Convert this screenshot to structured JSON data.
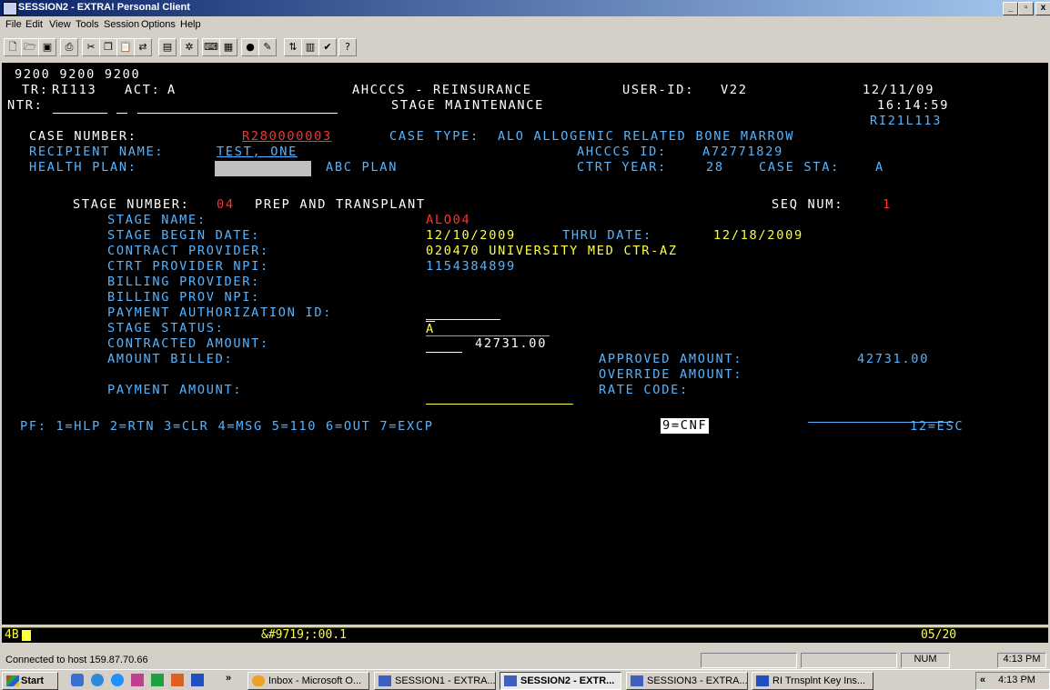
{
  "window": {
    "title": "SESSION2 - EXTRA! Personal Client",
    "controls": [
      "_",
      "&#9633;",
      "X"
    ]
  },
  "menu": [
    "File",
    "Edit",
    "View",
    "Tools",
    "Session",
    "Options",
    "Help"
  ],
  "toolbar_icons": [
    "new-icon",
    "open-icon",
    "save-icon",
    "print-icon",
    "cut-icon",
    "copy-icon",
    "paste-icon",
    "send-icon",
    "folder-icon",
    "settings-icon",
    "keyboard-icon",
    "macro-icon",
    "record-icon",
    "pen-icon",
    "transfer-icon",
    "report-icon",
    "check-icon",
    "help-icon"
  ],
  "screen": {
    "line0": "9200 9200 9200",
    "tr_label": "TR:",
    "tr_value": "RI113",
    "act_label": "ACT:",
    "act_value": "A",
    "system_title": "AHCCCS - REINSURANCE",
    "user_label": "USER-ID:",
    "user_value": "V22",
    "date": "12/11/09",
    "ntr_label": "NTR:",
    "screen_title": "STAGE MAINTENANCE",
    "time": "16:14:59",
    "screen_id": "RI21L113",
    "case_number_label": "CASE NUMBER:",
    "case_number": "R280000003",
    "case_type_label": "CASE TYPE:",
    "case_type": "ALO ALLOGENIC RELATED BONE MARROW",
    "recipient_label": "RECIPIENT NAME:",
    "recipient": "TEST, ONE",
    "ahcccs_id_label": "AHCCCS ID:",
    "ahcccs_id": "A72771829",
    "health_plan_label": "HEALTH PLAN:",
    "health_plan": "ABC PLAN",
    "ctrt_year_label": "CTRT YEAR:",
    "ctrt_year": "28",
    "case_sta_label": "CASE STA:",
    "case_sta": "A",
    "stage_number_label": "STAGE NUMBER:",
    "stage_number": "04",
    "stage_number_desc": "PREP AND TRANSPLANT",
    "seq_num_label": "SEQ NUM:",
    "seq_num": "1",
    "stage_name_label": "STAGE NAME:",
    "stage_name": "ALO04",
    "stage_begin_label": "STAGE BEGIN DATE:",
    "stage_begin": "12/10/2009",
    "thru_date_label": "THRU DATE:",
    "thru_date": "12/18/2009",
    "contract_provider_label": "CONTRACT PROVIDER:",
    "contract_provider": "020470 UNIVERSITY MED CTR-AZ",
    "ctrt_npi_label": "CTRT PROVIDER NPI:",
    "ctrt_npi": "1154384899",
    "billing_provider_label": "BILLING PROVIDER:",
    "billing_npi_label": "BILLING PROV NPI:",
    "payment_auth_label": "PAYMENT AUTHORIZATION ID:",
    "stage_status_label": "STAGE STATUS:",
    "stage_status": "A",
    "contracted_amount_label": "CONTRACTED AMOUNT:",
    "contracted_amount": "42731.00",
    "amount_billed_label": "AMOUNT BILLED:",
    "approved_amount_label": "APPROVED AMOUNT:",
    "approved_amount": "42731.00",
    "override_amount_label": "OVERRIDE AMOUNT:",
    "payment_amount_label": "PAYMENT AMOUNT:",
    "rate_code_label": "RATE CODE:",
    "pf_keys": "PF: 1=HLP 2=RTN 3=CLR 4=MSG 5=110 6=OUT 7=EXCP",
    "pf_key9": "9=CNF",
    "pf_key12": "12=ESC"
  },
  "oia": {
    "left": "4B",
    "timer": "&#9719;:00.1",
    "cursor": "05/20"
  },
  "statusbar": {
    "text": "Connected to host 159.87.70.66",
    "num": "NUM",
    "time": "4:13 PM"
  },
  "taskbar": {
    "start": "Start",
    "chevron": "»",
    "tasks": [
      "Inbox - Microsoft O...",
      "SESSION1 - EXTRA...",
      "SESSION2 - EXTR...",
      "SESSION3 - EXTRA...",
      "RI Trnsplnt Key Ins..."
    ],
    "tray_chevron": "«",
    "clock": "4:13 PM"
  },
  "colors": {
    "terminal_bg": "#000000",
    "label_cyan": "#56b4ff",
    "value_yellow": "#ffff40",
    "key_red": "#ff3030",
    "title_blue": "#0a246a"
  }
}
